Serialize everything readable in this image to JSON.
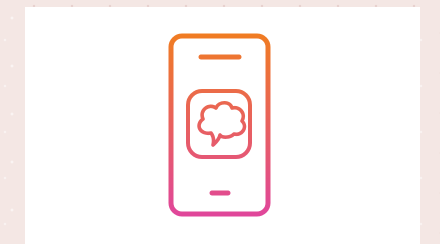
{
  "illustration": {
    "icon": "smartphone-chat-bubble-icon",
    "gradient_start": "#f07c22",
    "gradient_end": "#e0469b"
  },
  "background_color": "#f4e7e4",
  "card_color": "#ffffff"
}
